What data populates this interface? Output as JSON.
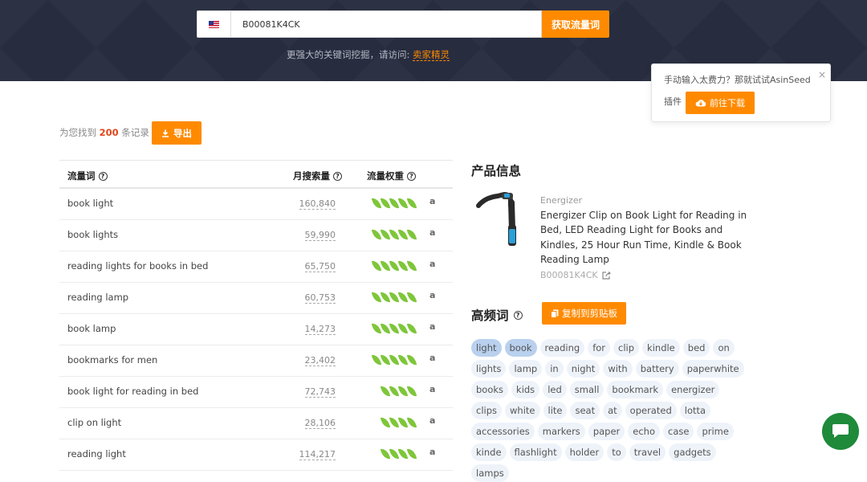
{
  "search": {
    "value": "B00081K4CK",
    "button_label": "获取流量词",
    "hint_text": "更强大的关键词挖掘，请访问: ",
    "hint_link": "卖家精灵"
  },
  "popup": {
    "text": "手动输入太费力？那就试试AsinSeed",
    "text2": "插件",
    "button_label": "前往下载",
    "close": "×"
  },
  "results": {
    "prefix": "为您找到",
    "count": "200",
    "suffix": "条记录",
    "export_label": "导出"
  },
  "table": {
    "headers": [
      "流量词",
      "月搜索量",
      "流量权重"
    ],
    "rows": [
      {
        "keyword": "book light",
        "volume": "160,840",
        "weight": 5
      },
      {
        "keyword": "book lights",
        "volume": "59,990",
        "weight": 5
      },
      {
        "keyword": "reading lights for books in bed",
        "volume": "65,750",
        "weight": 5
      },
      {
        "keyword": "reading lamp",
        "volume": "60,753",
        "weight": 5
      },
      {
        "keyword": "book lamp",
        "volume": "14,273",
        "weight": 5
      },
      {
        "keyword": "bookmarks for men",
        "volume": "23,402",
        "weight": 5
      },
      {
        "keyword": "book light for reading in bed",
        "volume": "72,743",
        "weight": 4
      },
      {
        "keyword": "clip on light",
        "volume": "28,106",
        "weight": 4
      },
      {
        "keyword": "reading light",
        "volume": "114,217",
        "weight": 4
      }
    ]
  },
  "product": {
    "section_title": "产品信息",
    "brand": "Energizer",
    "title": "Energizer Clip on Book Light for Reading in Bed, LED Reading Light for Books and Kindles, 25 Hour Run Time, Kindle & Book Reading Lamp",
    "asin": "B00081K4CK"
  },
  "keywords": {
    "section_title": "高频词",
    "copy_label": "复制到剪贴板",
    "tags": [
      {
        "text": "light",
        "hl": true
      },
      {
        "text": "book",
        "hl": true
      },
      {
        "text": "reading",
        "hl": false
      },
      {
        "text": "for",
        "hl": false
      },
      {
        "text": "clip",
        "hl": false
      },
      {
        "text": "kindle",
        "hl": false
      },
      {
        "text": "bed",
        "hl": false
      },
      {
        "text": "on",
        "hl": false
      },
      {
        "text": "lights",
        "hl": false
      },
      {
        "text": "lamp",
        "hl": false
      },
      {
        "text": "in",
        "hl": false
      },
      {
        "text": "night",
        "hl": false
      },
      {
        "text": "with",
        "hl": false
      },
      {
        "text": "battery",
        "hl": false
      },
      {
        "text": "paperwhite",
        "hl": false
      },
      {
        "text": "books",
        "hl": false
      },
      {
        "text": "kids",
        "hl": false
      },
      {
        "text": "led",
        "hl": false
      },
      {
        "text": "small",
        "hl": false
      },
      {
        "text": "bookmark",
        "hl": false
      },
      {
        "text": "energizer",
        "hl": false
      },
      {
        "text": "clips",
        "hl": false
      },
      {
        "text": "white",
        "hl": false
      },
      {
        "text": "lite",
        "hl": false
      },
      {
        "text": "seat",
        "hl": false
      },
      {
        "text": "at",
        "hl": false
      },
      {
        "text": "operated",
        "hl": false
      },
      {
        "text": "lotta",
        "hl": false
      },
      {
        "text": "accessories",
        "hl": false
      },
      {
        "text": "markers",
        "hl": false
      },
      {
        "text": "paper",
        "hl": false
      },
      {
        "text": "echo",
        "hl": false
      },
      {
        "text": "case",
        "hl": false
      },
      {
        "text": "prime",
        "hl": false
      },
      {
        "text": "kinde",
        "hl": false
      },
      {
        "text": "flashlight",
        "hl": false
      },
      {
        "text": "holder",
        "hl": false
      },
      {
        "text": "to",
        "hl": false
      },
      {
        "text": "travel",
        "hl": false
      },
      {
        "text": "gadgets",
        "hl": false
      },
      {
        "text": "lamps",
        "hl": false
      }
    ]
  },
  "amazon_icon": "a",
  "colors": {
    "accent": "#ff8a00",
    "hero_bg": "#272c3f",
    "leaf": "#7ec63a",
    "chat": "#1e8a3a"
  }
}
